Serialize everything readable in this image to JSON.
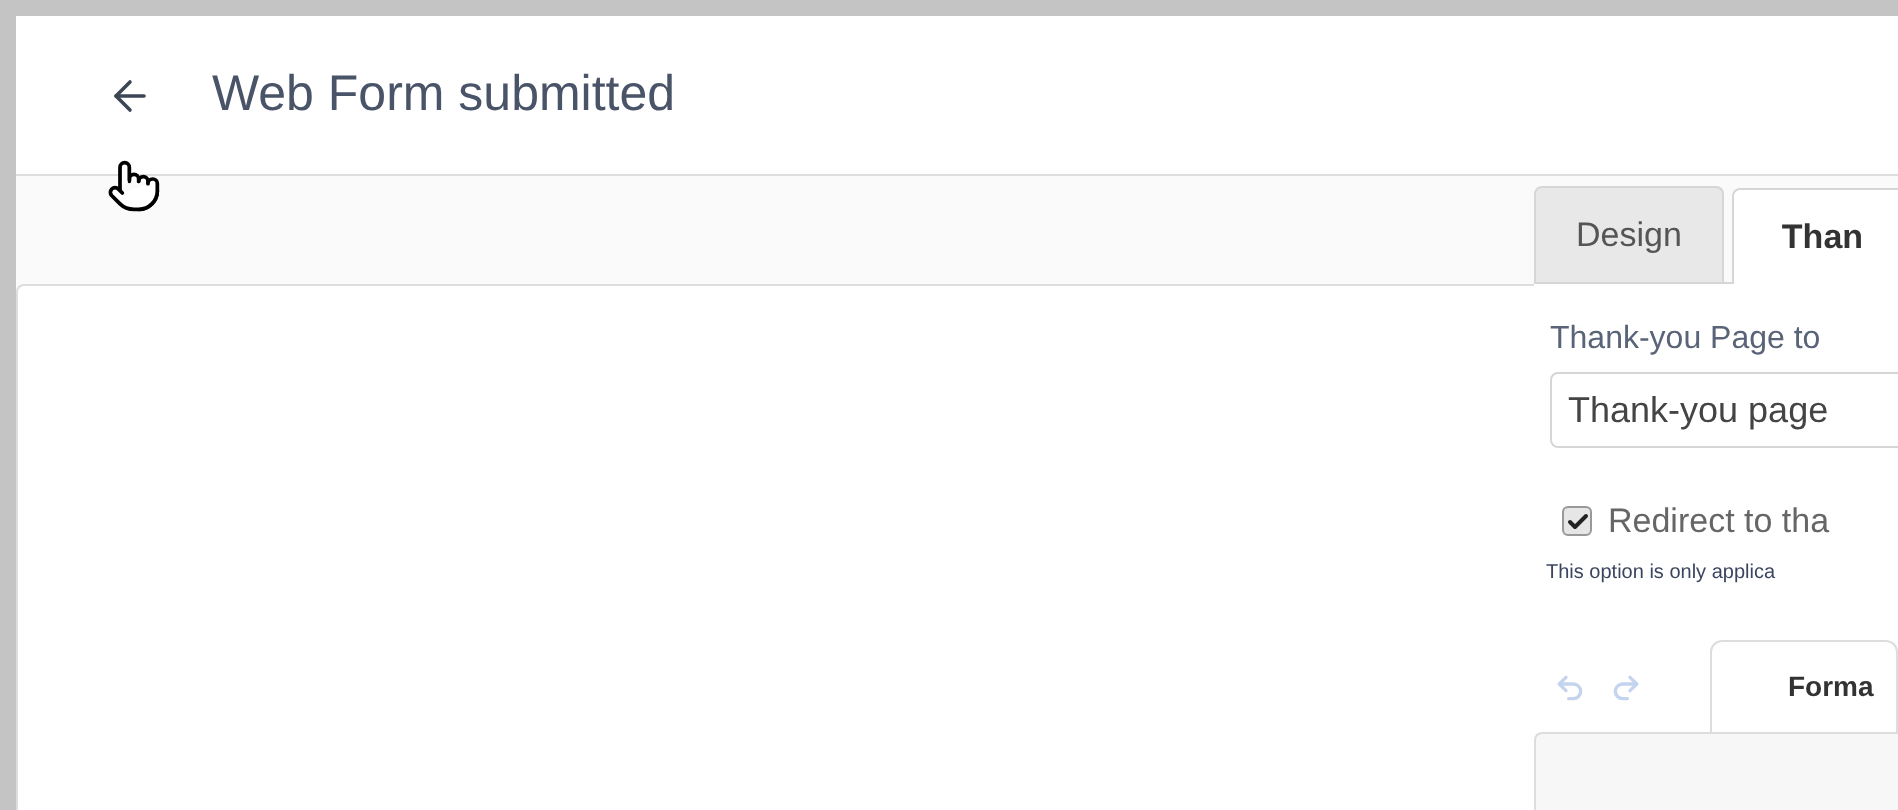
{
  "header": {
    "title": "Web Form submitted"
  },
  "tabs": [
    {
      "label": "Design",
      "selected": false
    },
    {
      "label": "Than",
      "selected": true
    }
  ],
  "thank_you": {
    "label": "Thank-you Page to",
    "value": "Thank-you page"
  },
  "redirect": {
    "label": "Redirect to tha",
    "checked": true,
    "note": "This option is only applica"
  },
  "history_buttons": [
    {
      "kind": "undo",
      "disabled": true
    },
    {
      "kind": "redo",
      "disabled": true
    }
  ],
  "editor_tabs": [
    {
      "label": "Forma",
      "selected": true
    }
  ]
}
